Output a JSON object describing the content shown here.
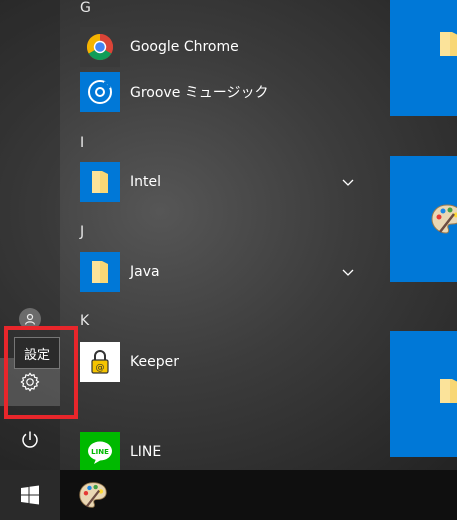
{
  "sections": {
    "g": "G",
    "i": "I",
    "j": "J",
    "k": "K"
  },
  "apps": {
    "chrome": "Google Chrome",
    "groove": "Groove ミュージック",
    "intel": "Intel",
    "java": "Java",
    "keeper": "Keeper",
    "line": "LINE"
  },
  "tooltip": {
    "settings": "設定"
  },
  "colors": {
    "accent": "#0078d7",
    "highlight": "#e8262b",
    "line_green": "#00b900"
  },
  "icons": {
    "user": "user-icon",
    "settings": "gear-icon",
    "power": "power-icon",
    "start": "windows-logo-icon",
    "paint": "paint-palette-icon"
  }
}
